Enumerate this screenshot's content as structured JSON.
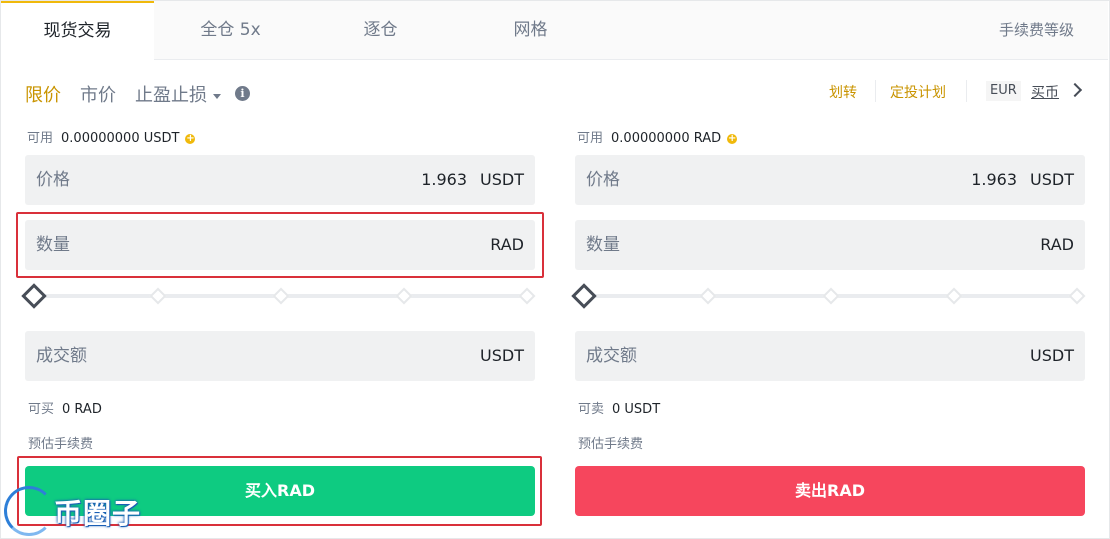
{
  "tabs": [
    {
      "label": "现货交易",
      "active": true
    },
    {
      "label": "全仓 5x",
      "active": false
    },
    {
      "label": "逐仓",
      "active": false
    },
    {
      "label": "网格",
      "active": false
    }
  ],
  "fee_level": "手续费等级",
  "order_types": {
    "limit": "限价",
    "market": "市价",
    "stop": "止盈止损"
  },
  "top_links": {
    "transfer": "划转",
    "plan": "定投计划",
    "currency": "EUR",
    "buy": "买币"
  },
  "buy": {
    "available_label": "可用",
    "available_value": "0.00000000 USDT",
    "price_label": "价格",
    "price_value": "1.963",
    "price_unit": "USDT",
    "amount_label": "数量",
    "amount_unit": "RAD",
    "total_label": "成交额",
    "total_unit": "USDT",
    "max_label": "可买",
    "max_value": "0 RAD",
    "fee_label": "预估手续费",
    "button": "买入RAD"
  },
  "sell": {
    "available_label": "可用",
    "available_value": "0.00000000 RAD",
    "price_label": "价格",
    "price_value": "1.963",
    "price_unit": "USDT",
    "amount_label": "数量",
    "amount_unit": "RAD",
    "total_label": "成交额",
    "total_unit": "USDT",
    "max_label": "可卖",
    "max_value": "0 USDT",
    "fee_label": "预估手续费",
    "button": "卖出RAD"
  },
  "slider_percent": 0,
  "colors": {
    "accent": "#f0b90b",
    "buy": "#0ecb81",
    "sell": "#f6465d",
    "highlight": "#d9303a"
  },
  "watermark": "币圈子"
}
